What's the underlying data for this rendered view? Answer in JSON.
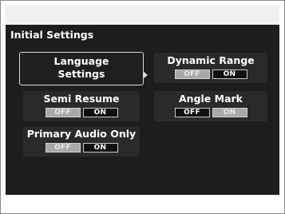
{
  "screen": {
    "title": "Initial Settings"
  },
  "settings": {
    "language": {
      "line1": "Language",
      "line2": "Settings"
    },
    "dynamic_range": {
      "label": "Dynamic Range",
      "off": "OFF",
      "on": "ON",
      "selected": "OFF"
    },
    "semi_resume": {
      "label": "Semi Resume",
      "off": "OFF",
      "on": "ON",
      "selected": "OFF"
    },
    "angle_mark": {
      "label": "Angle Mark",
      "off": "OFF",
      "on": "ON",
      "selected": "ON"
    },
    "primary_audio_only": {
      "label": "Primary Audio Only",
      "off": "OFF",
      "on": "ON",
      "selected": "OFF"
    }
  },
  "colors": {
    "screen_bg": "#1d1d1d",
    "tile_bg": "#2a2a2a",
    "selected_option": "#a9a9a9",
    "text": "#ffffff"
  }
}
